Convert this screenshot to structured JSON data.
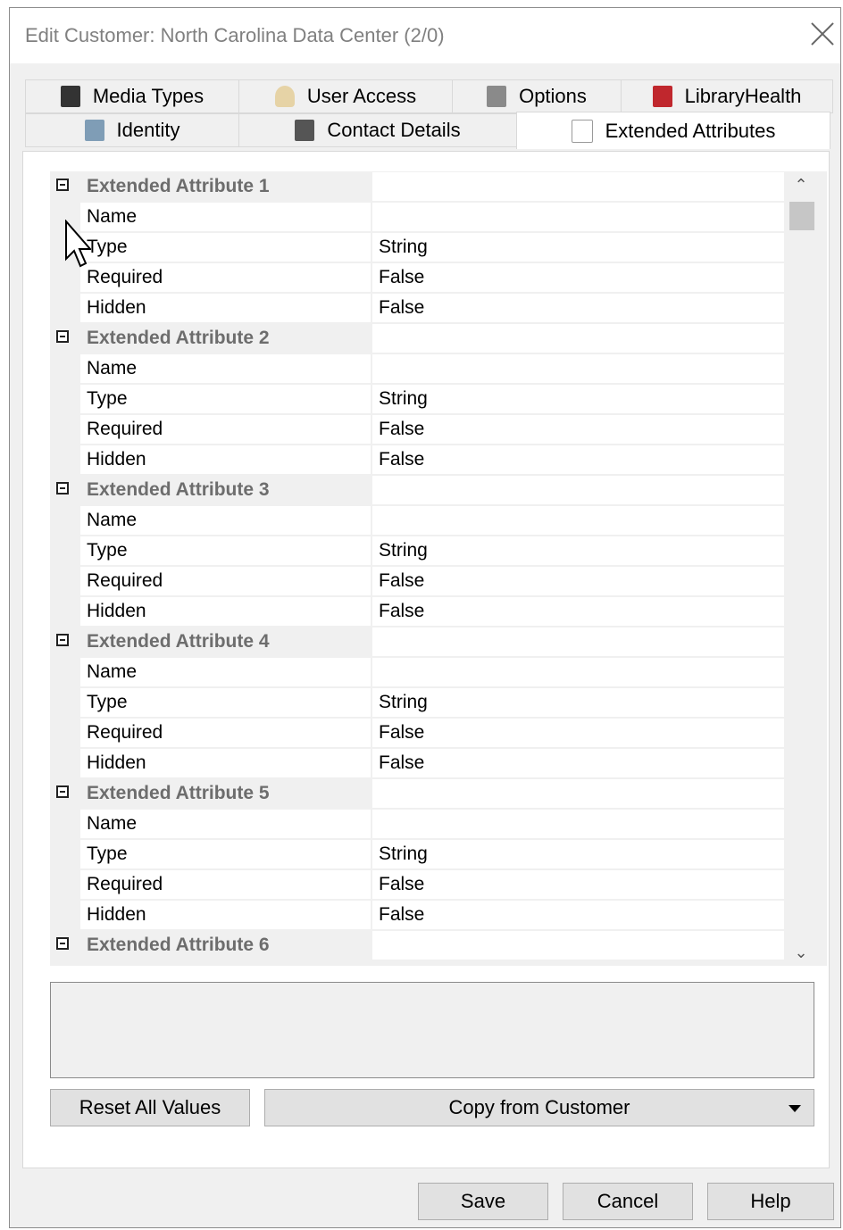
{
  "window": {
    "title": "Edit Customer: North Carolina Data Center (2/0)"
  },
  "tabs": {
    "row1": [
      {
        "label": "Media Types",
        "icon": "media-types-icon",
        "color": "#333333"
      },
      {
        "label": "User Access",
        "icon": "user-icon",
        "color": "#c8b07a"
      },
      {
        "label": "Options",
        "icon": "options-icon",
        "color": "#7a7a7a"
      },
      {
        "label": "LibraryHealth",
        "icon": "library-health-icon",
        "color": "#c0272d"
      }
    ],
    "row2": [
      {
        "label": "Identity",
        "icon": "identity-icon",
        "color": "#6e8fa8"
      },
      {
        "label": "Contact Details",
        "icon": "contact-details-icon",
        "color": "#555555"
      },
      {
        "label": "Extended Attributes",
        "icon": "extended-attributes-icon",
        "color": "#9a9a9a"
      }
    ],
    "active": "Extended Attributes"
  },
  "attributes": [
    {
      "header": "Extended Attribute 1",
      "rows": [
        {
          "k": "Name",
          "v": ""
        },
        {
          "k": "Type",
          "v": "String"
        },
        {
          "k": "Required",
          "v": "False"
        },
        {
          "k": "Hidden",
          "v": "False"
        }
      ]
    },
    {
      "header": "Extended Attribute 2",
      "rows": [
        {
          "k": "Name",
          "v": ""
        },
        {
          "k": "Type",
          "v": "String"
        },
        {
          "k": "Required",
          "v": "False"
        },
        {
          "k": "Hidden",
          "v": "False"
        }
      ]
    },
    {
      "header": "Extended Attribute 3",
      "rows": [
        {
          "k": "Name",
          "v": ""
        },
        {
          "k": "Type",
          "v": "String"
        },
        {
          "k": "Required",
          "v": "False"
        },
        {
          "k": "Hidden",
          "v": "False"
        }
      ]
    },
    {
      "header": "Extended Attribute 4",
      "rows": [
        {
          "k": "Name",
          "v": ""
        },
        {
          "k": "Type",
          "v": "String"
        },
        {
          "k": "Required",
          "v": "False"
        },
        {
          "k": "Hidden",
          "v": "False"
        }
      ]
    },
    {
      "header": "Extended Attribute 5",
      "rows": [
        {
          "k": "Name",
          "v": ""
        },
        {
          "k": "Type",
          "v": "String"
        },
        {
          "k": "Required",
          "v": "False"
        },
        {
          "k": "Hidden",
          "v": "False"
        }
      ]
    },
    {
      "header": "Extended Attribute 6",
      "rows": []
    }
  ],
  "buttons": {
    "reset": "Reset All Values",
    "copy": "Copy from Customer",
    "save": "Save",
    "cancel": "Cancel",
    "help": "Help"
  }
}
